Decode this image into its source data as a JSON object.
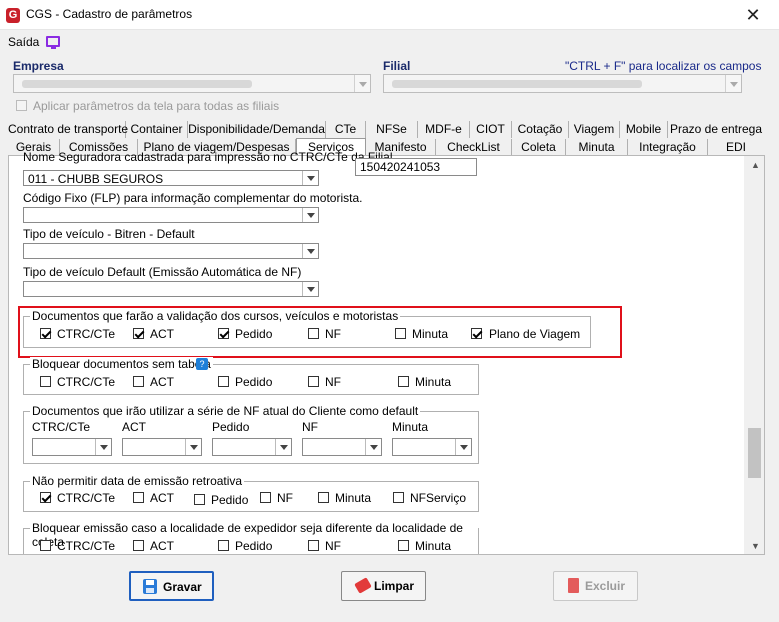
{
  "window": {
    "title": "CGS - Cadastro de parâmetros"
  },
  "menu": {
    "saida": "Saída"
  },
  "header": {
    "empresa_label": "Empresa",
    "filial_label": "Filial",
    "hint": "\"CTRL + F\" para localizar os campos",
    "aplicar_label": "Aplicar parâmetros da tela para todas as filiais"
  },
  "tabs_row1": [
    "Contrato de transporte",
    "Container",
    "Disponibilidade/Demanda",
    "CTe",
    "NFSe",
    "MDF-e",
    "CIOT",
    "Cotação",
    "Viagem",
    "Mobile",
    "Prazo de entrega"
  ],
  "tabs_row2": [
    "Gerais",
    "Comissões",
    "Plano de viagem/Despesas",
    "Serviços",
    "Manifesto",
    "CheckList",
    "Coleta",
    "Minuta",
    "Integração",
    "EDI"
  ],
  "content": {
    "seguradora_label": "Nome Seguradora cadastrada para impressão no CTRC/CTe da Filial",
    "seguradora_value": "011 - CHUBB SEGUROS",
    "apolice_value": "150420241053",
    "codigo_fixo_label": "Código Fixo (FLP) para informação complementar do motorista.",
    "tipo_bitren_label": "Tipo de veículo - Bitren - Default",
    "tipo_default_label": "Tipo de veículo Default (Emissão Automática de NF)",
    "docs_validacao": {
      "title": "Documentos que farão a validação dos cursos, veículos e motoristas",
      "items": [
        "CTRC/CTe",
        "ACT",
        "Pedido",
        "NF",
        "Minuta",
        "Plano de Viagem"
      ]
    },
    "bloquear_sem_tabela": {
      "title": "Bloquear documentos sem tabela",
      "items": [
        "CTRC/CTe",
        "ACT",
        "Pedido",
        "NF",
        "Minuta"
      ]
    },
    "serie_nf": {
      "title": "Documentos que irão utilizar a série de NF atual do Cliente  como default",
      "cols": [
        "CTRC/CTe",
        "ACT",
        "Pedido",
        "NF",
        "Minuta"
      ]
    },
    "nao_permitir": {
      "title": "Não permitir data de emissão retroativa",
      "items": [
        "CTRC/CTe",
        "ACT",
        "Pedido",
        "NF",
        "Minuta",
        "NFServiço"
      ]
    },
    "bloquear_emissao": {
      "title": "Bloquear emissão caso a localidade de expedidor seja diferente da localidade de coleta",
      "items": [
        "CTRC/CTe",
        "ACT",
        "Pedido",
        "NF",
        "Minuta"
      ]
    }
  },
  "buttons": {
    "gravar": "Gravar",
    "limpar": "Limpar",
    "excluir": "Excluir"
  },
  "colors": {
    "accent_blue": "#1f5fbf",
    "highlight_red": "#e0101a",
    "brand_red": "#c9202a"
  }
}
